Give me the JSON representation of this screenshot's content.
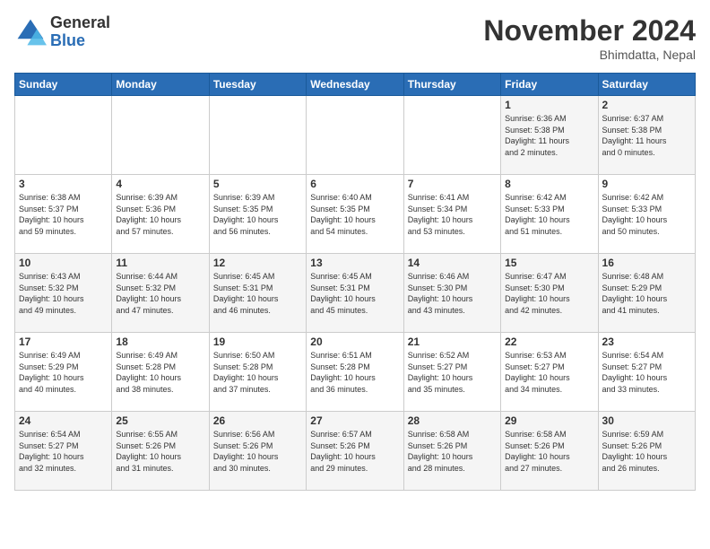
{
  "logo": {
    "general": "General",
    "blue": "Blue"
  },
  "title": "November 2024",
  "location": "Bhimdatta, Nepal",
  "days": [
    "Sunday",
    "Monday",
    "Tuesday",
    "Wednesday",
    "Thursday",
    "Friday",
    "Saturday"
  ],
  "weeks": [
    [
      {
        "day": "",
        "info": ""
      },
      {
        "day": "",
        "info": ""
      },
      {
        "day": "",
        "info": ""
      },
      {
        "day": "",
        "info": ""
      },
      {
        "day": "",
        "info": ""
      },
      {
        "day": "1",
        "info": "Sunrise: 6:36 AM\nSunset: 5:38 PM\nDaylight: 11 hours\nand 2 minutes."
      },
      {
        "day": "2",
        "info": "Sunrise: 6:37 AM\nSunset: 5:38 PM\nDaylight: 11 hours\nand 0 minutes."
      }
    ],
    [
      {
        "day": "3",
        "info": "Sunrise: 6:38 AM\nSunset: 5:37 PM\nDaylight: 10 hours\nand 59 minutes."
      },
      {
        "day": "4",
        "info": "Sunrise: 6:39 AM\nSunset: 5:36 PM\nDaylight: 10 hours\nand 57 minutes."
      },
      {
        "day": "5",
        "info": "Sunrise: 6:39 AM\nSunset: 5:35 PM\nDaylight: 10 hours\nand 56 minutes."
      },
      {
        "day": "6",
        "info": "Sunrise: 6:40 AM\nSunset: 5:35 PM\nDaylight: 10 hours\nand 54 minutes."
      },
      {
        "day": "7",
        "info": "Sunrise: 6:41 AM\nSunset: 5:34 PM\nDaylight: 10 hours\nand 53 minutes."
      },
      {
        "day": "8",
        "info": "Sunrise: 6:42 AM\nSunset: 5:33 PM\nDaylight: 10 hours\nand 51 minutes."
      },
      {
        "day": "9",
        "info": "Sunrise: 6:42 AM\nSunset: 5:33 PM\nDaylight: 10 hours\nand 50 minutes."
      }
    ],
    [
      {
        "day": "10",
        "info": "Sunrise: 6:43 AM\nSunset: 5:32 PM\nDaylight: 10 hours\nand 49 minutes."
      },
      {
        "day": "11",
        "info": "Sunrise: 6:44 AM\nSunset: 5:32 PM\nDaylight: 10 hours\nand 47 minutes."
      },
      {
        "day": "12",
        "info": "Sunrise: 6:45 AM\nSunset: 5:31 PM\nDaylight: 10 hours\nand 46 minutes."
      },
      {
        "day": "13",
        "info": "Sunrise: 6:45 AM\nSunset: 5:31 PM\nDaylight: 10 hours\nand 45 minutes."
      },
      {
        "day": "14",
        "info": "Sunrise: 6:46 AM\nSunset: 5:30 PM\nDaylight: 10 hours\nand 43 minutes."
      },
      {
        "day": "15",
        "info": "Sunrise: 6:47 AM\nSunset: 5:30 PM\nDaylight: 10 hours\nand 42 minutes."
      },
      {
        "day": "16",
        "info": "Sunrise: 6:48 AM\nSunset: 5:29 PM\nDaylight: 10 hours\nand 41 minutes."
      }
    ],
    [
      {
        "day": "17",
        "info": "Sunrise: 6:49 AM\nSunset: 5:29 PM\nDaylight: 10 hours\nand 40 minutes."
      },
      {
        "day": "18",
        "info": "Sunrise: 6:49 AM\nSunset: 5:28 PM\nDaylight: 10 hours\nand 38 minutes."
      },
      {
        "day": "19",
        "info": "Sunrise: 6:50 AM\nSunset: 5:28 PM\nDaylight: 10 hours\nand 37 minutes."
      },
      {
        "day": "20",
        "info": "Sunrise: 6:51 AM\nSunset: 5:28 PM\nDaylight: 10 hours\nand 36 minutes."
      },
      {
        "day": "21",
        "info": "Sunrise: 6:52 AM\nSunset: 5:27 PM\nDaylight: 10 hours\nand 35 minutes."
      },
      {
        "day": "22",
        "info": "Sunrise: 6:53 AM\nSunset: 5:27 PM\nDaylight: 10 hours\nand 34 minutes."
      },
      {
        "day": "23",
        "info": "Sunrise: 6:54 AM\nSunset: 5:27 PM\nDaylight: 10 hours\nand 33 minutes."
      }
    ],
    [
      {
        "day": "24",
        "info": "Sunrise: 6:54 AM\nSunset: 5:27 PM\nDaylight: 10 hours\nand 32 minutes."
      },
      {
        "day": "25",
        "info": "Sunrise: 6:55 AM\nSunset: 5:26 PM\nDaylight: 10 hours\nand 31 minutes."
      },
      {
        "day": "26",
        "info": "Sunrise: 6:56 AM\nSunset: 5:26 PM\nDaylight: 10 hours\nand 30 minutes."
      },
      {
        "day": "27",
        "info": "Sunrise: 6:57 AM\nSunset: 5:26 PM\nDaylight: 10 hours\nand 29 minutes."
      },
      {
        "day": "28",
        "info": "Sunrise: 6:58 AM\nSunset: 5:26 PM\nDaylight: 10 hours\nand 28 minutes."
      },
      {
        "day": "29",
        "info": "Sunrise: 6:58 AM\nSunset: 5:26 PM\nDaylight: 10 hours\nand 27 minutes."
      },
      {
        "day": "30",
        "info": "Sunrise: 6:59 AM\nSunset: 5:26 PM\nDaylight: 10 hours\nand 26 minutes."
      }
    ]
  ]
}
